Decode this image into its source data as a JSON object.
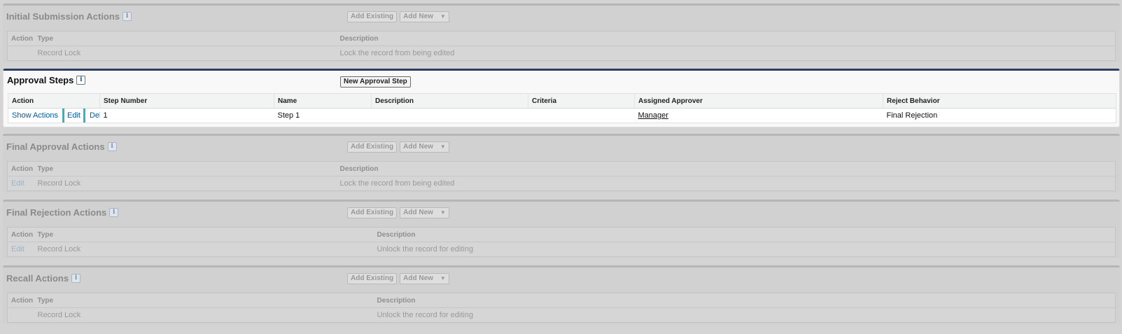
{
  "initial_submission": {
    "title": "Initial Submission Actions",
    "add_existing": "Add Existing",
    "add_new": "Add New",
    "columns": [
      "Action",
      "Type",
      "Description"
    ],
    "rows": [
      {
        "action": "",
        "type": "Record Lock",
        "description": "Lock the record from being edited"
      }
    ]
  },
  "approval_steps": {
    "title": "Approval Steps",
    "new_step_button": "New Approval Step",
    "columns": [
      "Action",
      "Step Number",
      "Name",
      "Description",
      "Criteria",
      "Assigned Approver",
      "Reject Behavior"
    ],
    "rows": [
      {
        "show_actions": "Show Actions",
        "edit": "Edit",
        "del": "Del",
        "step_number": "1",
        "name": "Step 1",
        "description": "",
        "criteria": "",
        "assigned_approver": "Manager",
        "reject_behavior": "Final Rejection"
      }
    ]
  },
  "final_approval": {
    "title": "Final Approval Actions",
    "add_existing": "Add Existing",
    "add_new": "Add New",
    "columns": [
      "Action",
      "Type",
      "Description"
    ],
    "rows": [
      {
        "action": "Edit",
        "type": "Record Lock",
        "description": "Lock the record from being edited"
      }
    ]
  },
  "final_rejection": {
    "title": "Final Rejection Actions",
    "add_existing": "Add Existing",
    "add_new": "Add New",
    "columns": [
      "Action",
      "Type",
      "Description"
    ],
    "rows": [
      {
        "action": "Edit",
        "type": "Record Lock",
        "description": "Unlock the record for editing"
      }
    ]
  },
  "recall": {
    "title": "Recall Actions",
    "add_existing": "Add Existing",
    "add_new": "Add New",
    "columns": [
      "Action",
      "Type",
      "Description"
    ],
    "rows": [
      {
        "action": "",
        "type": "Record Lock",
        "description": "Unlock the record for editing"
      }
    ]
  },
  "icons": {
    "info": "info-icon",
    "dropdown": "chevron-down-icon"
  },
  "colors": {
    "highlight": "#26b8c8",
    "link": "#015ba7",
    "active_border": "#2e3f66"
  }
}
